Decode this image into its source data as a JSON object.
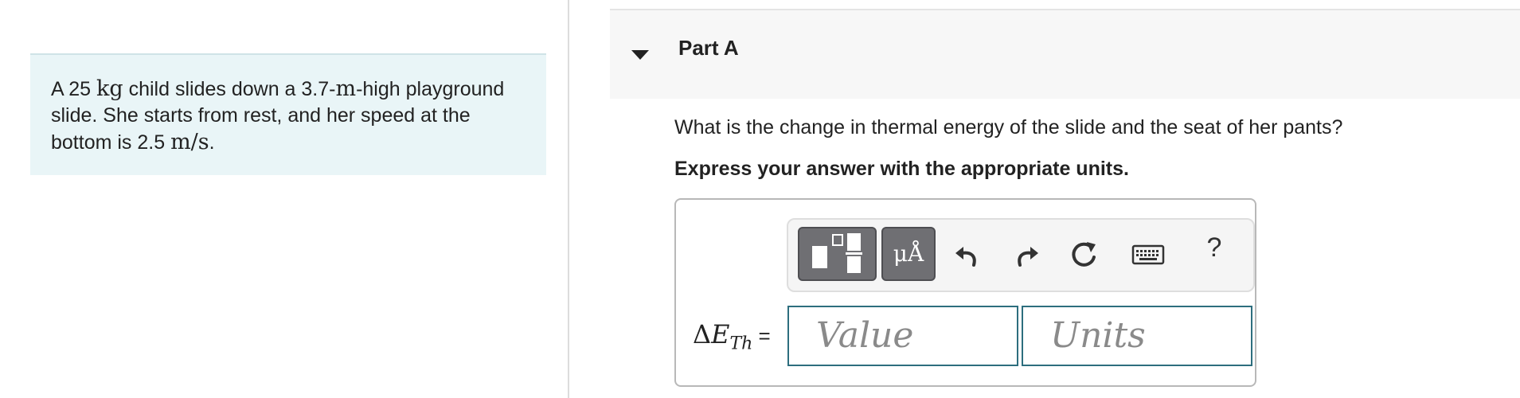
{
  "problem": {
    "line1": {
      "a": "A 25 ",
      "m1": "kg",
      "b": " child slides down a 3.7-",
      "m2": "m",
      "c": "-high playground"
    },
    "line2": "slide. She starts from rest, and her speed at the",
    "line3": {
      "a": "bottom is 2.5 ",
      "m": "m/s",
      "b": "."
    }
  },
  "part": {
    "title": "Part A",
    "question": "What is the change in thermal energy of the slide and the seat of her pants?",
    "instruction": "Express your answer with the appropriate units."
  },
  "toolbar": {
    "symbols_label": "μÅ",
    "help_label": "?",
    "icons": [
      "templates-icon",
      "undo-icon",
      "redo-icon",
      "reset-icon",
      "keyboard-icon"
    ]
  },
  "answer": {
    "delta": "Δ",
    "var": "E",
    "sub": "Th",
    "equals": " =",
    "value_placeholder": "Value",
    "units_placeholder": "Units"
  }
}
